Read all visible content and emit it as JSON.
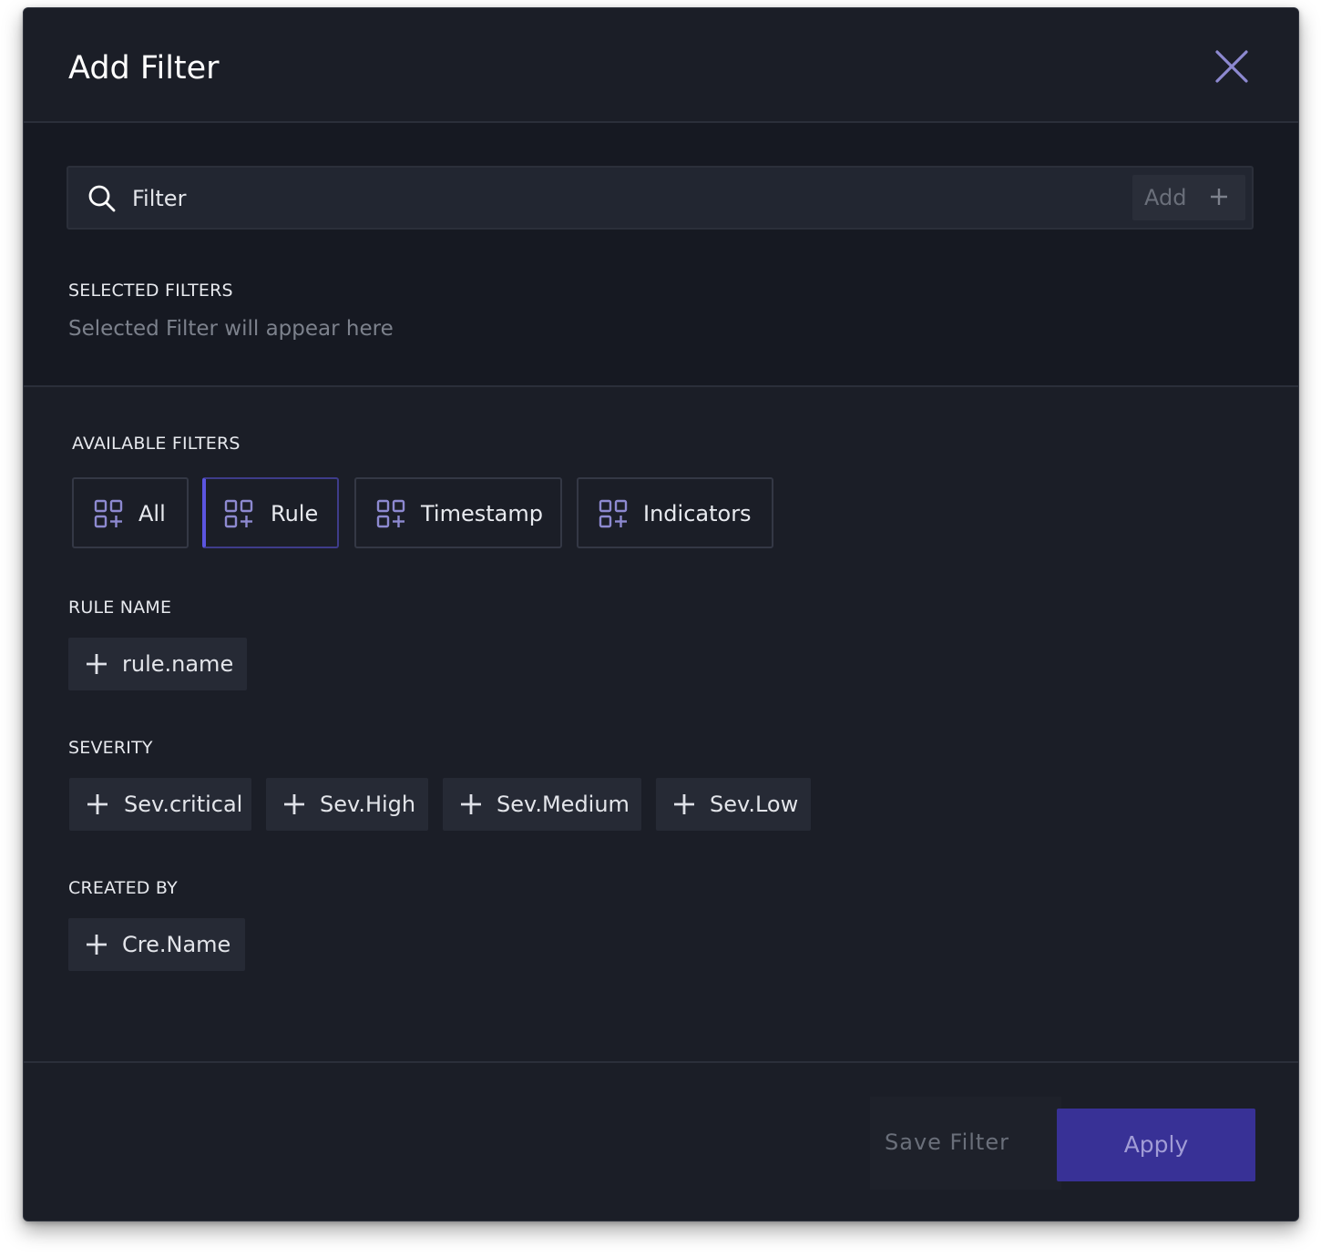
{
  "header": {
    "title": "Add Filter",
    "close_icon": "close-icon"
  },
  "search": {
    "value": "",
    "placeholder": "Filter",
    "add_label": "Add"
  },
  "selected": {
    "label": "SELECTED FILTERS",
    "empty_hint": "Selected Filter will appear here"
  },
  "available": {
    "label": "AVAILABLE FILTERS",
    "tabs": [
      {
        "label": "All",
        "active": false
      },
      {
        "label": "Rule",
        "active": true
      },
      {
        "label": "Timestamp",
        "active": false
      },
      {
        "label": "Indicators",
        "active": false
      }
    ]
  },
  "groups": {
    "rule_name": {
      "label": "RULE NAME",
      "chips": [
        "rule.name"
      ]
    },
    "severity": {
      "label": "SEVERITY",
      "chips": [
        "Sev.critical",
        "Sev.High",
        "Sev.Medium",
        "Sev.Low"
      ]
    },
    "created_by": {
      "label": "CREATED BY",
      "chips": [
        "Cre.Name"
      ]
    }
  },
  "footer": {
    "save_label": "Save Filter",
    "apply_label": "Apply"
  },
  "colors": {
    "accent": "#5b55e0",
    "apply_bg": "#383196",
    "modal_bg": "#1b1e27"
  }
}
